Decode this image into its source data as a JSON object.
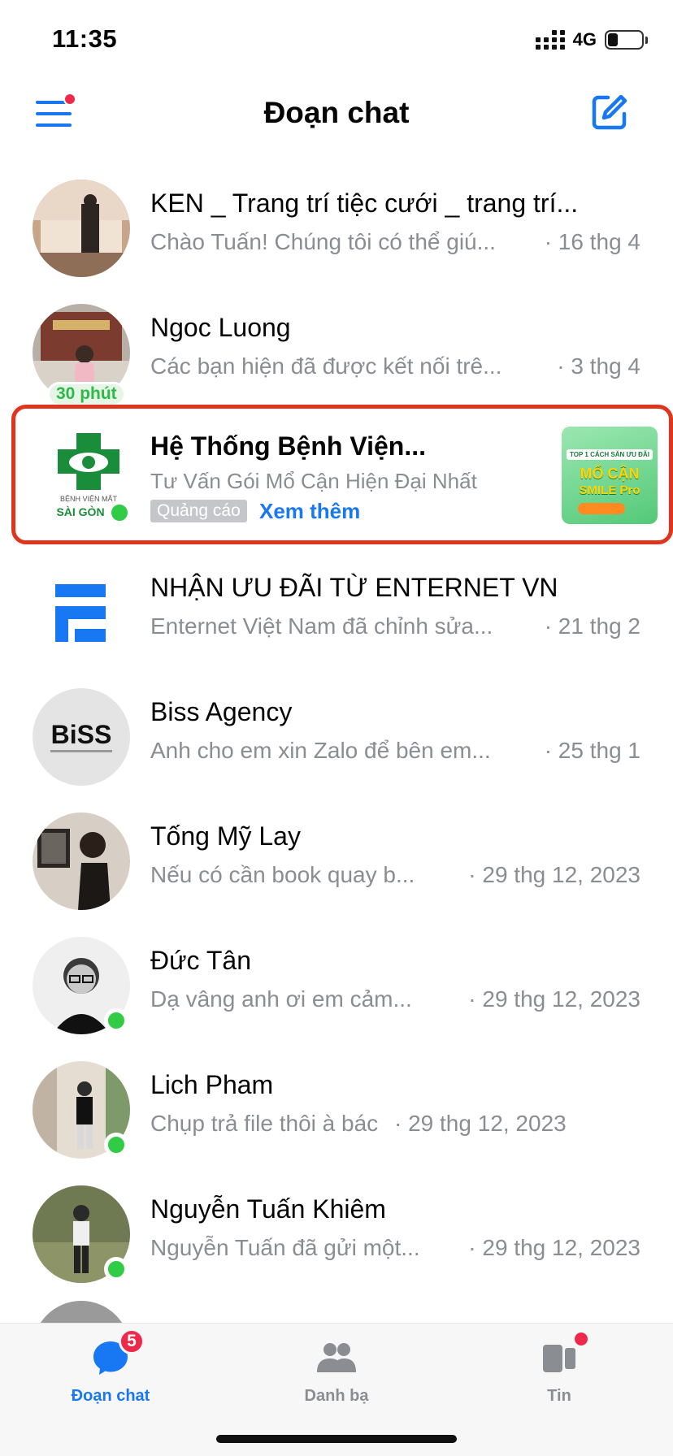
{
  "status_bar": {
    "time": "11:35",
    "network": "4G"
  },
  "header": {
    "title": "Đoạn chat"
  },
  "chats": [
    {
      "name": "KEN _ Trang trí tiệc cưới _ trang trí...",
      "preview": "Chào Tuấn! Chúng tôi có thể giú...",
      "time": "· 16 thg 4",
      "online": false
    },
    {
      "name": "Ngoc Luong",
      "preview": "Các bạn hiện đã được kết nối trê...",
      "time": "· 3 thg 4",
      "active_chip": "30 phút",
      "online": false
    },
    {
      "name": "NHẬN ƯU ĐÃI TỪ ENTERNET VN",
      "preview": "Enternet Việt Nam đã chỉnh sửa...",
      "time": "· 21 thg 2",
      "online": false
    },
    {
      "name": "Biss Agency",
      "preview": "Anh cho em xin Zalo để bên em...",
      "time": "· 25 thg 1",
      "online": false
    },
    {
      "name": "Tống Mỹ Lay",
      "preview": "Nếu có cần book quay b...",
      "time": "· 29 thg 12, 2023",
      "online": false
    },
    {
      "name": "Đức Tân",
      "preview": "Dạ vâng anh ơi em cảm...",
      "time": "· 29 thg 12, 2023",
      "online": true
    },
    {
      "name": "Lich Pham",
      "preview": "Chụp trả file thôi à bác",
      "time": "· 29 thg 12, 2023",
      "online": true
    },
    {
      "name": "Nguyễn Tuấn Khiêm",
      "preview": "Nguyễn Tuấn đã gửi một...",
      "time": "· 29 thg 12, 2023",
      "online": true
    }
  ],
  "ad": {
    "name": "Hệ Thống Bệnh Viện...",
    "description": "Tư Vấn Gói Mổ Cận Hiện Đại Nhất",
    "tag": "Quảng cáo",
    "cta": "Xem thêm",
    "logo_text_1": "BỆNH VIỆN MẮT",
    "logo_text_2": "SÀI GÒN",
    "image_text_1": "TOP 1 CÁCH SĂN ƯU ĐÃI",
    "image_text_2": "MỔ CẬN",
    "image_text_3": "SMILE Pro"
  },
  "tabs": [
    {
      "label": "Đoạn chat",
      "badge": "5",
      "active": true,
      "icon": "chat-bubble-icon"
    },
    {
      "label": "Danh bạ",
      "active": false,
      "icon": "people-icon"
    },
    {
      "label": "Tin",
      "active": false,
      "icon": "stories-icon"
    }
  ],
  "colors": {
    "accent": "#1877f2",
    "online": "#31cc46",
    "badge": "#f02849",
    "ad_highlight": "#e0341c"
  }
}
